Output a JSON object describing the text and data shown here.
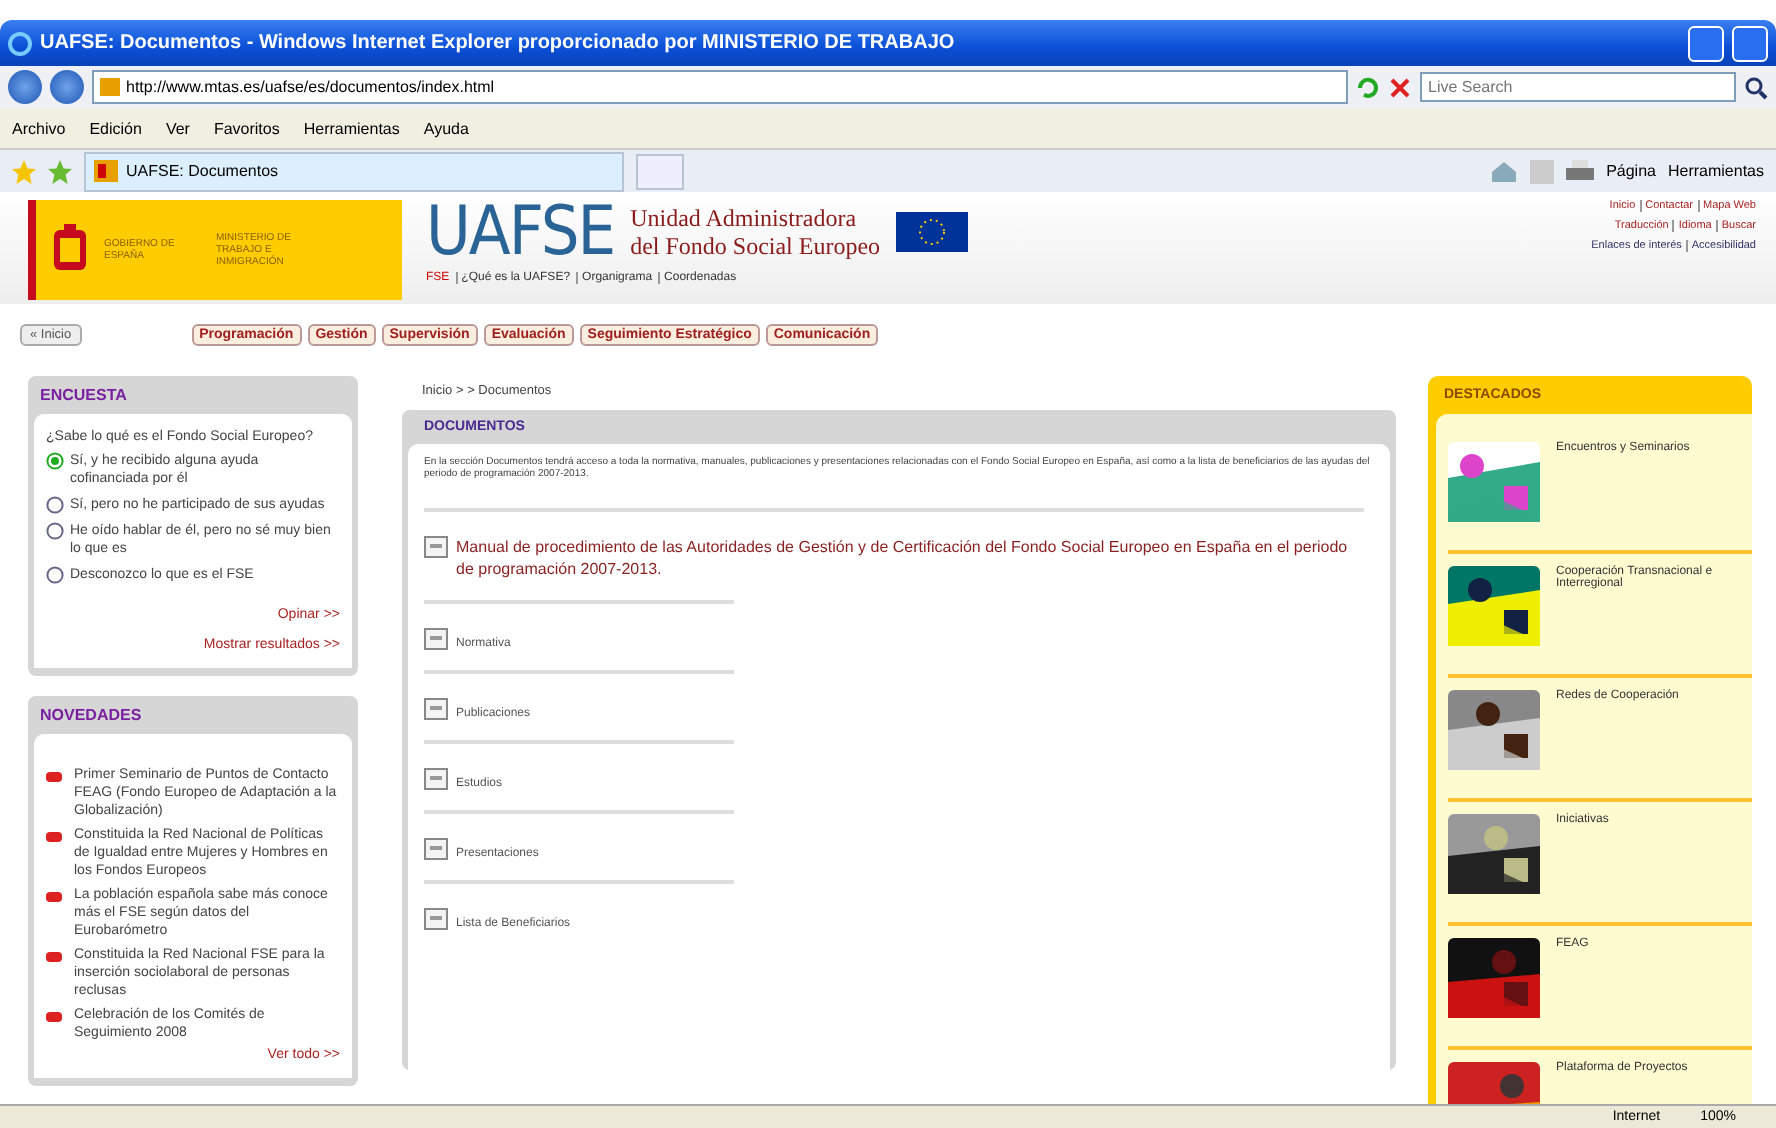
{
  "window": {
    "title": "UAFSE: Documentos - Windows Internet Explorer proporcionado por MINISTERIO DE TRABAJO"
  },
  "address_bar": {
    "url": "http://www.mtas.es/uafse/es/documentos/index.html"
  },
  "search": {
    "placeholder": "Live Search"
  },
  "menu": [
    "Archivo",
    "Edición",
    "Ver",
    "Favoritos",
    "Herramientas",
    "Ayuda"
  ],
  "tabs": [
    {
      "label": "UAFSE: Documentos",
      "selected": true
    }
  ],
  "command_bar": [
    "Página",
    "Herramientas"
  ],
  "site": {
    "ministry": "GOBIERNO DE ESPAÑA",
    "ministry_2": "MINISTERIO DE TRABAJO E INMIGRACIÓN",
    "logo": "UAFSE",
    "name_1": "Unidad Administradora",
    "name_2": "del Fondo Social Europeo",
    "top_links": [
      [
        "Inicio",
        "Contactar",
        "Mapa Web"
      ],
      [
        "Traducción",
        "Idioma",
        "Buscar"
      ],
      [
        "Enlaces de interés",
        "Accesibilidad"
      ]
    ],
    "sub_nav": [
      "FSE",
      "¿Qué es la UAFSE?",
      "Organigrama",
      "Coordenadas"
    ]
  },
  "home_button": "« Inicio",
  "sections": [
    "Programación",
    "Gestión",
    "Supervisión",
    "Evaluación",
    "Seguimiento Estratégico",
    "Comunicación"
  ],
  "poll": {
    "title": "ENCUESTA",
    "question": "¿Sabe lo qué es el Fondo Social Europeo?",
    "options": [
      {
        "label": "Sí, y he recibido alguna ayuda cofinanciada por él",
        "selected": true
      },
      {
        "label": "Sí, pero no he participado de sus ayudas",
        "selected": false
      },
      {
        "label": "He oído hablar de él, pero no sé muy bien lo que es",
        "selected": false
      },
      {
        "label": "Desconozco lo que es el FSE",
        "selected": false
      }
    ],
    "links": [
      "Opinar >>",
      "Mostrar resultados >>"
    ]
  },
  "news": {
    "title": "NOVEDADES",
    "items": [
      "Primer Seminario de Puntos de Contacto FEAG (Fondo Europeo de Adaptación a la Globalización)",
      "Constituida la Red Nacional de Políticas de Igualdad entre Mujeres y Hombres en los Fondos Europeos",
      "La población española sabe más conoce más el FSE según datos del Eurobarómetro",
      "Constituida la Red Nacional FSE para la inserción sociolaboral de personas reclusas",
      "Celebración de los Comités de Seguimiento 2008"
    ],
    "more": "Ver todo >>"
  },
  "breadcrumb": "Inicio > > Documentos",
  "documents": {
    "title": "DOCUMENTOS",
    "intro": "En la sección Documentos tendrá acceso a toda la normativa, manuales, publicaciones y presentaciones relacionadas con el Fondo Social Europeo en España, así como a la lista de beneficiarios de las ayudas del periodo de programación 2007-2013.",
    "items": [
      {
        "kind": "main",
        "label": "Manual de procedimiento de las Autoridades de Gestión y de Certificación del Fondo Social Europeo en España en el periodo de programación 2007-2013."
      },
      {
        "kind": "link",
        "label": "Normativa"
      },
      {
        "kind": "link",
        "label": "Publicaciones"
      },
      {
        "kind": "link",
        "label": "Estudios"
      },
      {
        "kind": "link",
        "label": "Presentaciones"
      },
      {
        "kind": "link",
        "label": "Lista de Beneficiarios"
      }
    ]
  },
  "highlights": {
    "title": "DESTACADOS",
    "items": [
      "Encuentros y Seminarios",
      "Cooperación Transnacional e Interregional",
      "Redes de Cooperación",
      "Iniciativas",
      "FEAG",
      "Plataforma de Proyectos"
    ]
  },
  "status_bar": {
    "zone": "Internet",
    "zoom": "100%"
  }
}
